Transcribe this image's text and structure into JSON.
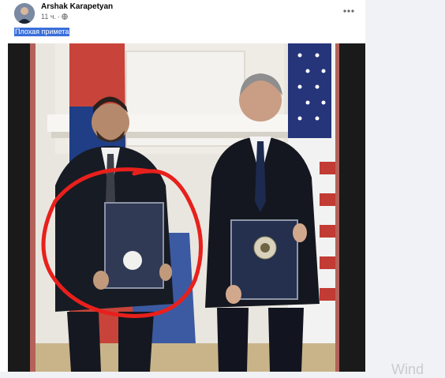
{
  "post": {
    "author": "Arshak Karapetyan",
    "time": "11 ч.",
    "separator": "·",
    "caption": "Плохая примета",
    "photo_icon": "photo-two-men-holding-folders",
    "more_icon": "more-dots-icon",
    "privacy_icon": "globe-icon"
  },
  "overlay": {
    "watermark": "Wind"
  },
  "colors": {
    "caption_highlight": "#3a6fdb",
    "annotation_circle": "#e8201c",
    "frame_border": "#c05a52"
  }
}
